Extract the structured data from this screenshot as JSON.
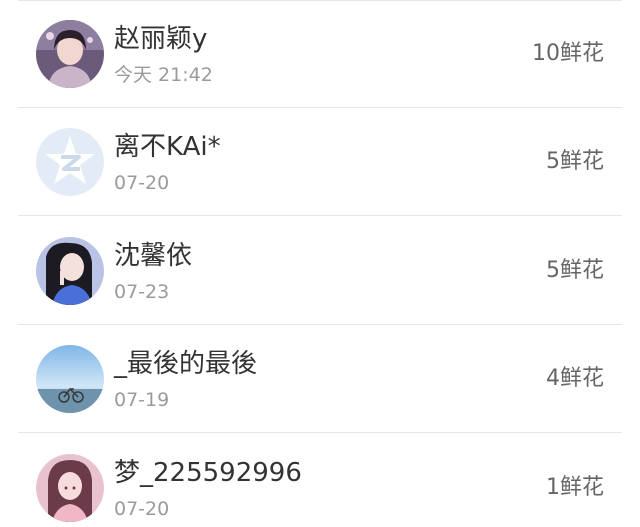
{
  "items": [
    {
      "name": "赵丽颖y",
      "time": "今天 21:42",
      "flowers": "10鲜花",
      "avatar": "portrait-woman-avatar"
    },
    {
      "name": "离不KAi*",
      "time": "07-20",
      "flowers": "5鲜花",
      "avatar": "default-z-logo-avatar"
    },
    {
      "name": "沈馨依",
      "time": "07-23",
      "flowers": "5鲜花",
      "avatar": "portrait-woman-avatar"
    },
    {
      "name": "_最後的最後",
      "time": "07-19",
      "flowers": "4鲜花",
      "avatar": "sky-bicycle-avatar"
    },
    {
      "name": "梦_225592996",
      "time": "07-20",
      "flowers": "1鲜花",
      "avatar": "portrait-girl-avatar"
    }
  ],
  "colors": {
    "name": "#333333",
    "time": "#9b9b9b",
    "flowers": "#666666",
    "divider": "#e6e6e6",
    "default_avatar_bg": "#e3ecf6"
  }
}
